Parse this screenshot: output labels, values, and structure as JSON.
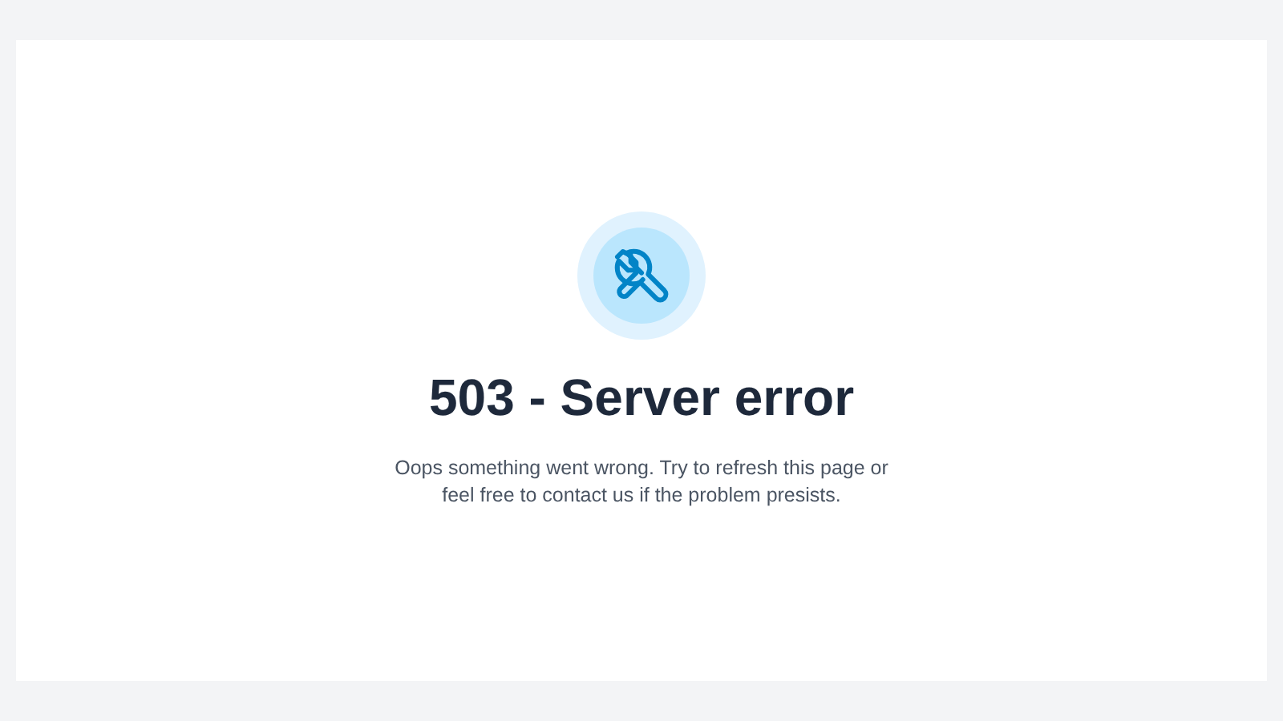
{
  "error": {
    "title": "503 - Server error",
    "message": "Oops something went wrong. Try to refresh this page or feel free to contact us if the problem presists."
  }
}
